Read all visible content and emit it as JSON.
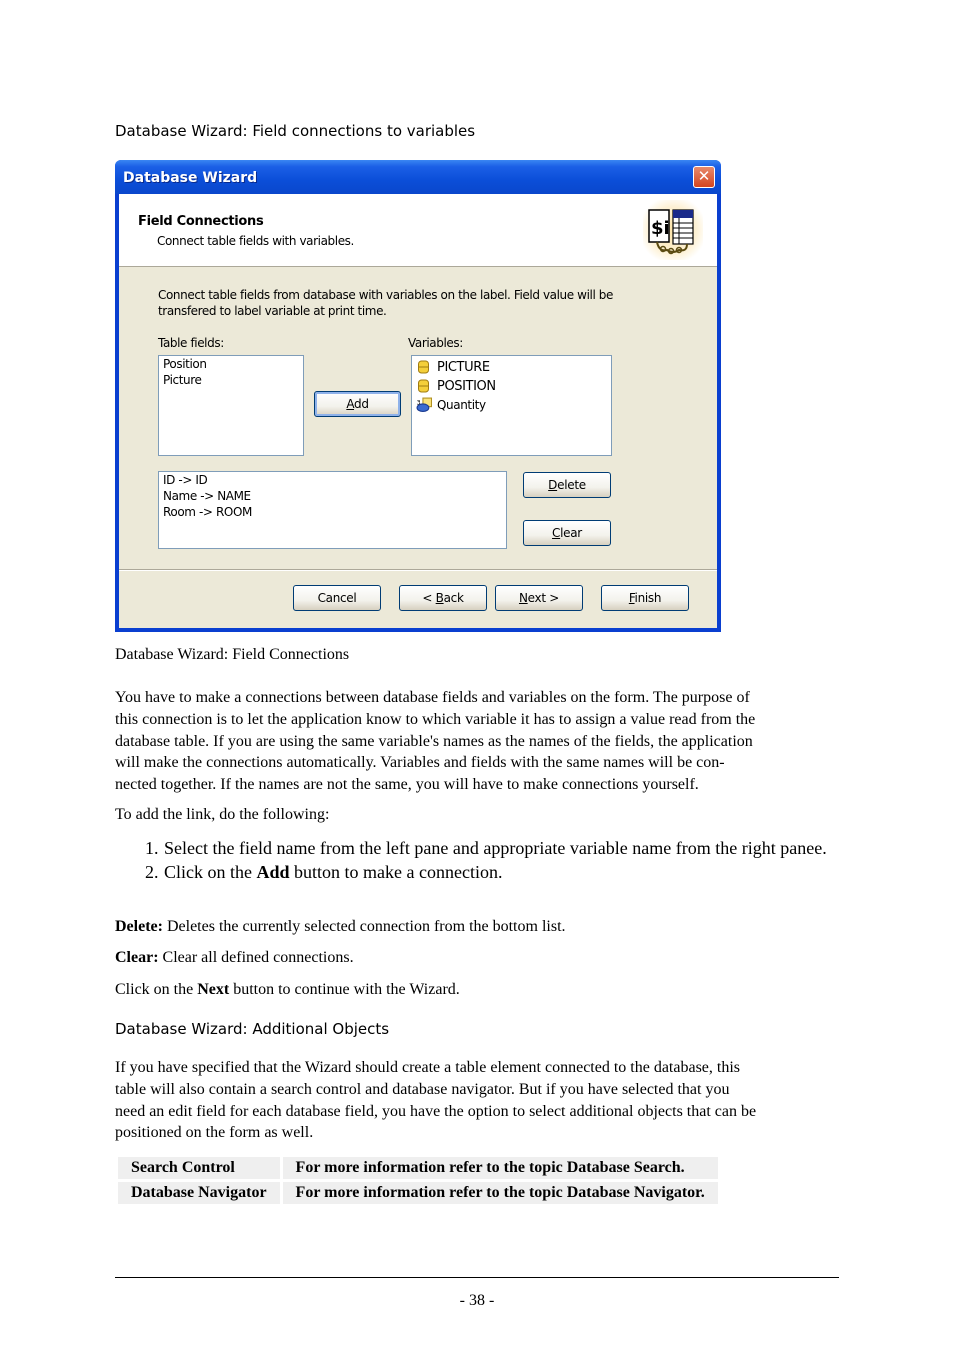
{
  "section_heading": "Database Wizard: Field connections to variables",
  "dialog": {
    "title": "Database Wizard",
    "close_glyph": "✕",
    "header": {
      "title": "Field Connections",
      "subtitle": "Connect table fields with variables.",
      "icon": "variable-table-link-icon"
    },
    "description_line1": "Connect table fields from database with variables on the label. Field value will be",
    "description_line2": "transfered to label variable at print time.",
    "table_fields": {
      "label": "Table fields:",
      "items": [
        "Position",
        "Picture"
      ]
    },
    "variables": {
      "label": "Variables:",
      "items": [
        {
          "name": "PICTURE",
          "icon": "database-variable-icon"
        },
        {
          "name": "POSITION",
          "icon": "database-variable-icon"
        },
        {
          "name": "Quantity",
          "icon": "counter-variable-icon"
        }
      ]
    },
    "add_button": {
      "access_key": "A",
      "rest": "dd"
    },
    "connections": {
      "items": [
        "ID -> ID",
        "Name -> NAME",
        "Room -> ROOM"
      ]
    },
    "delete_button": {
      "access_key": "D",
      "rest": "elete"
    },
    "clear_button": {
      "access_key": "C",
      "rest": "lear"
    },
    "footer_buttons": {
      "cancel": "Cancel",
      "back_prefix": "< ",
      "back_key": "B",
      "back_rest": "ack",
      "next_key": "N",
      "next_rest": "ext >",
      "finish_key": "F",
      "finish_rest": "inish"
    }
  },
  "caption": "Database Wizard: Field Connections",
  "intro_paragraph": {
    "lines": [
      "You have to make a connections between database fields and variables on the form. The purpose of",
      "this connection is to let the application know to which variable it has to assign a value read from the",
      "database table. If you are using the same variable's names as the names of the fields, the application",
      "will make the connections automatically. Variables and fields with the same names will be con-",
      "nected together. If the names are not the same, you will have to make connections yourself."
    ]
  },
  "steps_intro": "To add the link, do the following:",
  "steps": {
    "step1": "Select the field name from the left pane and appropriate variable name from the right panee.",
    "step2_before": "Click on the ",
    "step2_bold": "Add",
    "step2_after": " button to make a connection."
  },
  "delete_note": {
    "bold": "Delete:",
    "text": " Deletes the currently selected connection from the bottom list."
  },
  "clear_note": {
    "bold": "Clear:",
    "text": " Clear all defined connections."
  },
  "next_note": {
    "before": "Click on the ",
    "bold": "Next",
    "after": " button to continue with the Wizard."
  },
  "additional_heading": "Database Wizard: Additional Objects",
  "additional_paragraph": {
    "lines": [
      "If you have specified that the Wizard should create a table element connected to the database, this",
      "table will also contain a search control and database navigator. But if you have selected that you",
      "need an edit field for each database field, you have the option to select additional objects that can be",
      "positioned on the form as well."
    ]
  },
  "objects_table": {
    "rows": [
      {
        "name": "Search Control",
        "description": "For more information refer to the topic Database Search."
      },
      {
        "name": "Database Navigator",
        "description": "For more information refer to the topic Database Navigator."
      }
    ]
  },
  "page_number": "- 38 -"
}
